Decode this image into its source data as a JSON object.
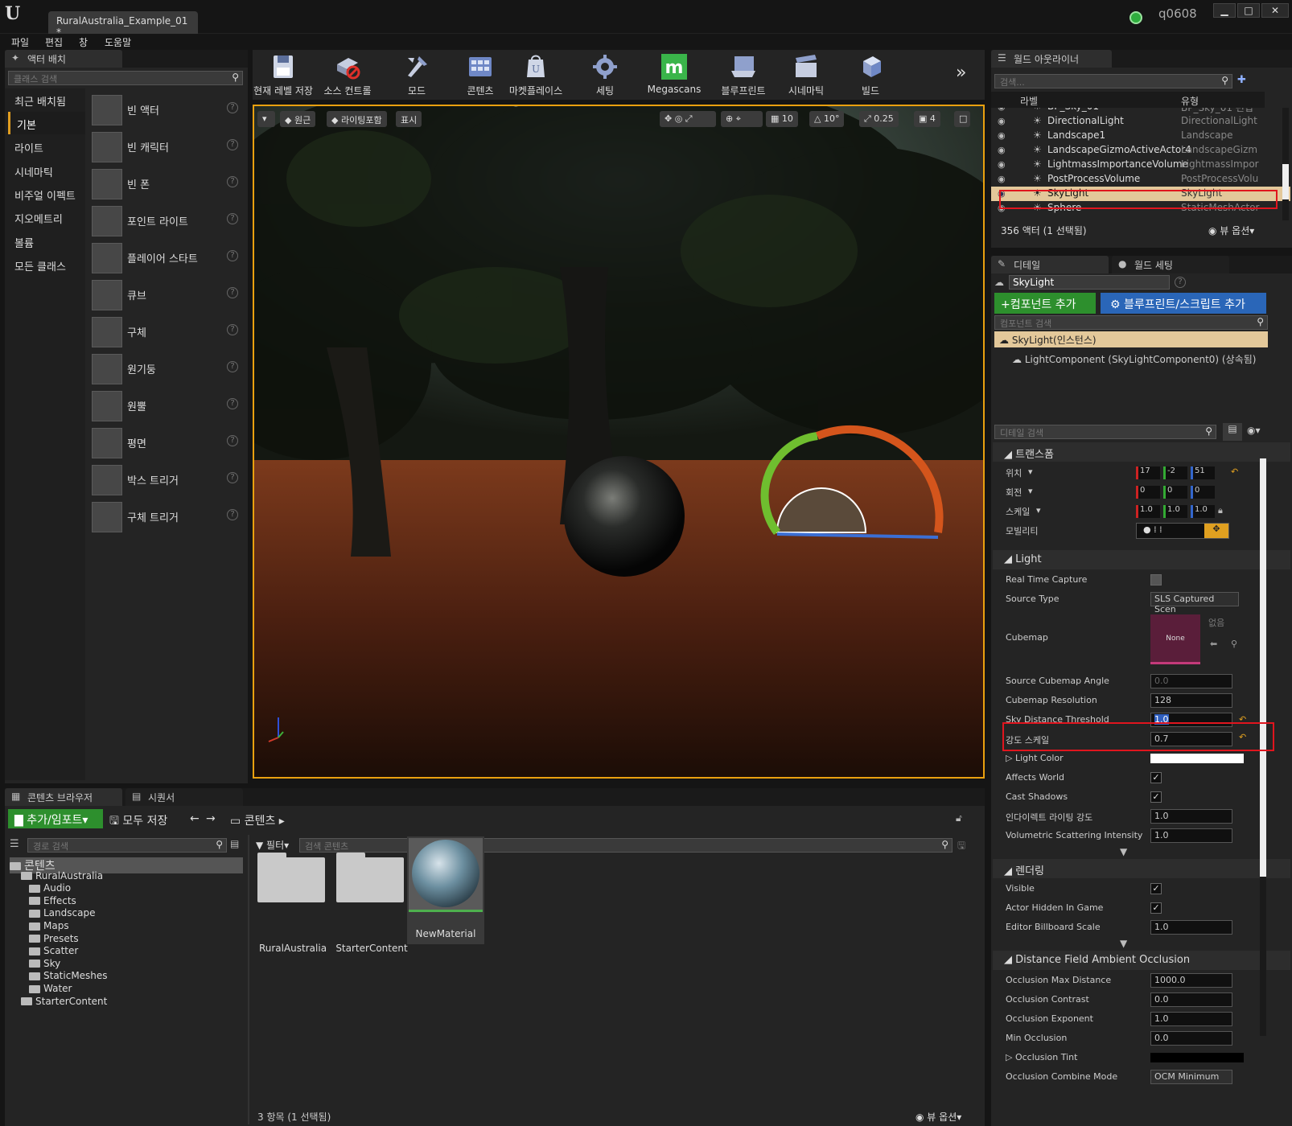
{
  "titlebar": {
    "doc_tab": "RuralAustralia_Example_01",
    "user": "q0608",
    "win_min": "▁",
    "win_max": "□",
    "win_close": "✕"
  },
  "menu": [
    "파일",
    "편집",
    "창",
    "도움말"
  ],
  "place_actors": {
    "tab": "액터 배치",
    "search_placeholder": "클래스 검색",
    "categories": [
      "최근 배치됨",
      "기본",
      "라이트",
      "시네마틱",
      "비주얼 이펙트",
      "지오메트리",
      "볼륨",
      "모든 클래스"
    ],
    "selected_category": "기본",
    "actors": [
      "빈 액터",
      "빈 캐릭터",
      "빈 폰",
      "포인트 라이트",
      "플레이어 스타트",
      "큐브",
      "구체",
      "원기둥",
      "원뿔",
      "평면",
      "박스 트리거",
      "구체 트리거"
    ]
  },
  "toolbar": {
    "buttons": [
      {
        "label": "현재 레벨 저장",
        "icon": "save-icon"
      },
      {
        "label": "소스 컨트롤",
        "icon": "source-control-icon"
      },
      {
        "label": "모드",
        "icon": "modes-icon"
      },
      {
        "label": "콘텐츠",
        "icon": "content-icon"
      },
      {
        "label": "마켓플레이스",
        "icon": "marketplace-icon"
      },
      {
        "label": "세팅",
        "icon": "settings-icon"
      },
      {
        "label": "Megascans",
        "icon": "megascans-icon"
      },
      {
        "label": "블루프린트",
        "icon": "blueprint-icon"
      },
      {
        "label": "시네마틱",
        "icon": "cinematics-icon"
      },
      {
        "label": "빌드",
        "icon": "build-icon"
      }
    ],
    "more": "»"
  },
  "viewport": {
    "perspective": "원근",
    "view_mode": "라이팅포함",
    "show": "표시",
    "grid_snap": "10",
    "rot_snap": "10°",
    "scale_snap": "0.25",
    "cam_speed": "4"
  },
  "outliner": {
    "tab": "월드 아웃라이너",
    "search_placeholder": "검색...",
    "col_label": "라벨",
    "col_type": "유형",
    "rows": [
      {
        "name": "BP_Sky_01",
        "type": "BP_Sky_01 편집"
      },
      {
        "name": "DirectionalLight",
        "type": "DirectionalLight"
      },
      {
        "name": "Landscape1",
        "type": "Landscape"
      },
      {
        "name": "LandscapeGizmoActiveActor4",
        "type": "LandscapeGizm"
      },
      {
        "name": "LightmassImportanceVolume",
        "type": "LightmassImpor"
      },
      {
        "name": "PostProcessVolume",
        "type": "PostProcessVolu"
      },
      {
        "name": "SkyLight",
        "type": "SkyLight"
      },
      {
        "name": "Sphere",
        "type": "StaticMeshActor"
      }
    ],
    "selected": "SkyLight",
    "status": "356 액터 (1 선택됨)",
    "view_options": "뷰 옵션"
  },
  "details": {
    "tab_details": "디테일",
    "tab_world": "월드 세팅",
    "actor_name": "SkyLight",
    "add_component": "+컴포넌트 추가",
    "add_blueprint": "블루프린트/스크립트 추가",
    "comp_search": "컴포넌트 검색",
    "comp_instance": "SkyLight(인스턴스)",
    "comp_light": "LightComponent (SkyLightComponent0) (상속됨)",
    "detail_search": "디테일 검색",
    "transform": {
      "title": "트랜스폼",
      "location": "위치",
      "loc": [
        "17",
        "-2",
        "51"
      ],
      "rotation": "회전",
      "rot": [
        "0",
        "0",
        "0"
      ],
      "scale": "스케일",
      "scl": [
        "1.0",
        "1.0",
        "1.0"
      ],
      "mobility": "모빌리티"
    },
    "light": {
      "title": "Light",
      "real_time_capture": "Real Time Capture",
      "source_type": "Source Type",
      "source_type_val": "SLS Captured Scen",
      "cubemap": "Cubemap",
      "cubemap_val": "None",
      "cubemap_none": "없음",
      "source_cubemap_angle": "Source Cubemap Angle",
      "source_cubemap_angle_val": "0.0",
      "cubemap_resolution": "Cubemap Resolution",
      "cubemap_resolution_val": "128",
      "sky_distance_threshold": "Sky Distance Threshold",
      "sky_distance_threshold_val": "1.0",
      "intensity_scale": "강도 스케일",
      "intensity_scale_val": "0.7",
      "light_color": "Light Color",
      "affects_world": "Affects World",
      "cast_shadows": "Cast Shadows",
      "indirect": "인다이렉트 라이팅 강도",
      "indirect_val": "1.0",
      "volumetric": "Volumetric Scattering Intensity",
      "volumetric_val": "1.0"
    },
    "rendering": {
      "title": "렌더링",
      "visible": "Visible",
      "hidden_in_game": "Actor Hidden In Game",
      "billboard": "Editor Billboard Scale",
      "billboard_val": "1.0"
    },
    "dfao": {
      "title": "Distance Field Ambient Occlusion",
      "max_distance": "Occlusion Max Distance",
      "max_distance_val": "1000.0",
      "contrast": "Occlusion Contrast",
      "contrast_val": "0.0",
      "exponent": "Occlusion Exponent",
      "exponent_val": "1.0",
      "min_occ": "Min Occlusion",
      "min_occ_val": "0.0",
      "tint": "Occlusion Tint",
      "combine": "Occlusion Combine Mode",
      "combine_val": "OCM Minimum"
    }
  },
  "content_browser": {
    "tab": "콘텐츠 브라우저",
    "tab2": "시퀀서",
    "add_import": "추가/임포트",
    "save_all": "모두 저장",
    "path": "콘텐츠",
    "path_search": "경로 검색",
    "filter": "필터",
    "content_search": "검색 콘텐츠",
    "tree": [
      {
        "name": "콘텐츠",
        "depth": 0
      },
      {
        "name": "RuralAustralia",
        "depth": 1
      },
      {
        "name": "Audio",
        "depth": 2
      },
      {
        "name": "Effects",
        "depth": 2
      },
      {
        "name": "Landscape",
        "depth": 2
      },
      {
        "name": "Maps",
        "depth": 2
      },
      {
        "name": "Presets",
        "depth": 2
      },
      {
        "name": "Scatter",
        "depth": 2
      },
      {
        "name": "Sky",
        "depth": 2
      },
      {
        "name": "StaticMeshes",
        "depth": 2
      },
      {
        "name": "Water",
        "depth": 2
      },
      {
        "name": "StarterContent",
        "depth": 1
      }
    ],
    "assets": [
      "RuralAustralia",
      "StarterContent",
      "NewMaterial"
    ],
    "status": "3 항목 (1 선택됨)",
    "view_options": "뷰 옵션"
  }
}
